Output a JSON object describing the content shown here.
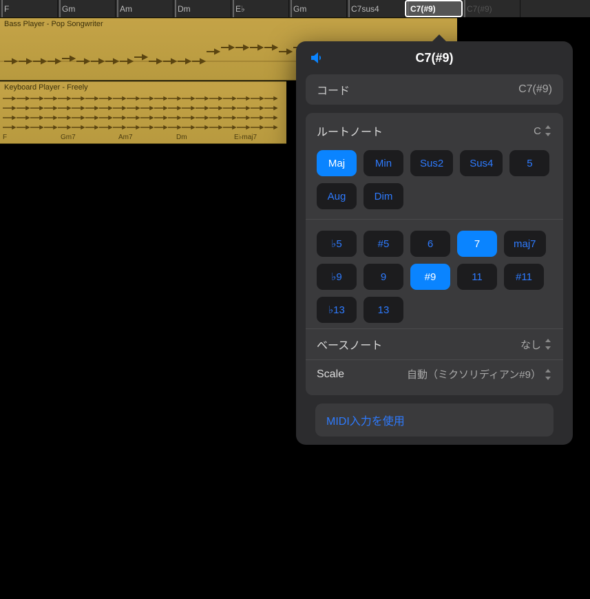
{
  "chord_strip": {
    "chords": [
      "F",
      "Gm",
      "Am",
      "Dm",
      "E♭",
      "Gm",
      "C7sus4",
      "C7(#9)",
      "C7(#9)"
    ],
    "selected_index": 7
  },
  "tracks": [
    {
      "name": "Bass Player - Pop Songwriter"
    },
    {
      "name": "Keyboard Player - Freely",
      "chord_labels": [
        "F",
        "Gm7",
        "Am7",
        "Dm",
        "E♭maj7"
      ]
    }
  ],
  "popover": {
    "title": "C7(#9)",
    "chord_row": {
      "label": "コード",
      "value": "C7(#9)"
    },
    "root_row": {
      "label": "ルートノート",
      "value": "C"
    },
    "quality_buttons": [
      {
        "label": "Maj",
        "active": true
      },
      {
        "label": "Min",
        "active": false
      },
      {
        "label": "Sus2",
        "active": false
      },
      {
        "label": "Sus4",
        "active": false
      },
      {
        "label": "5",
        "active": false
      },
      {
        "label": "Aug",
        "active": false
      },
      {
        "label": "Dim",
        "active": false
      }
    ],
    "ext_buttons": [
      {
        "label": "♭5",
        "active": false
      },
      {
        "label": "#5",
        "active": false
      },
      {
        "label": "6",
        "active": false
      },
      {
        "label": "7",
        "active": true
      },
      {
        "label": "maj7",
        "active": false
      },
      {
        "label": "♭9",
        "active": false
      },
      {
        "label": "9",
        "active": false
      },
      {
        "label": "#9",
        "active": true
      },
      {
        "label": "11",
        "active": false
      },
      {
        "label": "#11",
        "active": false
      },
      {
        "label": "♭13",
        "active": false
      },
      {
        "label": "13",
        "active": false
      }
    ],
    "bass_row": {
      "label": "ベースノート",
      "value": "なし"
    },
    "scale_row": {
      "label": "Scale",
      "value": "自動（ミクソリディアン#9）"
    },
    "midi_button": "MIDI入力を使用",
    "speaker_icon": "speaker-icon"
  }
}
